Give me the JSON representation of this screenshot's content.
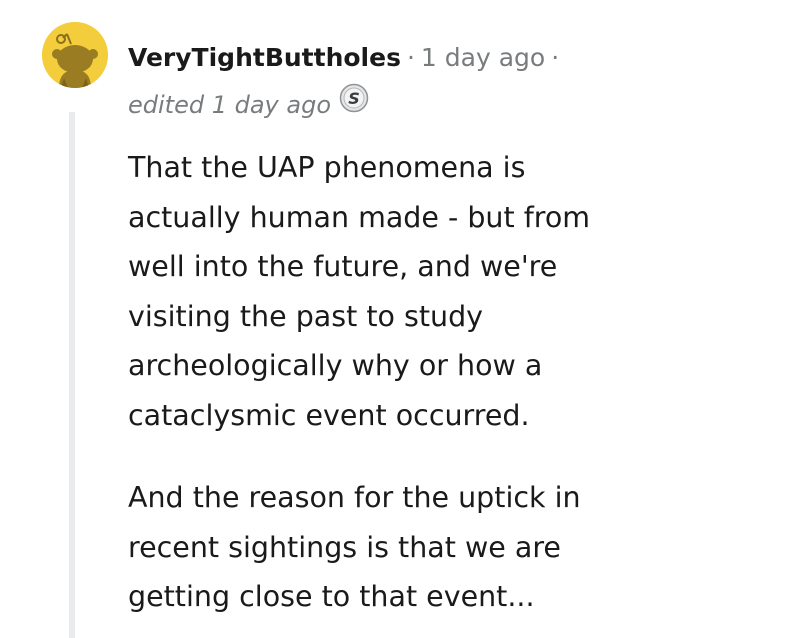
{
  "comment": {
    "username": "VeryTightButtholes",
    "separator": "·",
    "timestamp": "1 day ago",
    "trailing_separator": "·",
    "edited": "edited 1 day ago",
    "award_icon": "silver-award-icon",
    "avatar_icon": "snoo-avatar-icon",
    "paragraphs": [
      "That the UAP phenomena is\nactually human made - but from\nwell into the future, and we're\nvisiting the past to study\narcheologically why or how a\ncataclysmic event occurred.",
      "And the reason for the uptick in\nrecent sightings is that we are\ngetting close to that event..."
    ]
  },
  "colors": {
    "avatar_background": "#f4cd3c",
    "thread_line": "#e9ebed",
    "meta_text": "#787c7e",
    "body_text": "#1a1a1b"
  }
}
